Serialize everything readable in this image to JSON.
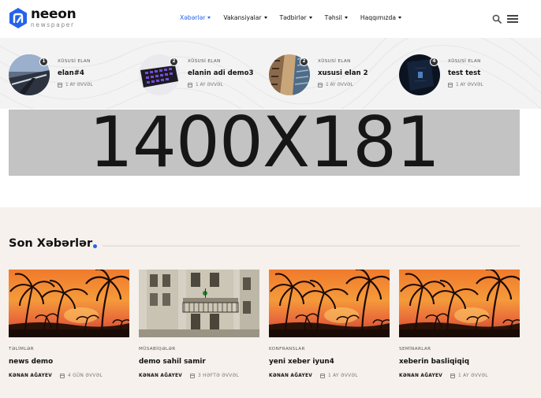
{
  "brand": {
    "name": "neeon",
    "tagline": "newspaper",
    "accent": "#2563eb"
  },
  "nav": [
    {
      "label": "Xəbərlər",
      "active": true
    },
    {
      "label": "Vakansiyalar",
      "active": false
    },
    {
      "label": "Tədbirlər",
      "active": false
    },
    {
      "label": "Təhsil",
      "active": false
    },
    {
      "label": "Haqqımızda",
      "active": false
    }
  ],
  "featured": [
    {
      "num": "1",
      "kicker": "XÜSUSİ ELAN",
      "title": "elan#4",
      "date": "1 AY ƏVVƏL",
      "icon": "landscape-thumb"
    },
    {
      "num": "2",
      "kicker": "XÜSUSİ ELAN",
      "title": "elanin adi demo3",
      "date": "1 AY ƏVVƏL",
      "icon": "keyboard-thumb"
    },
    {
      "num": "2",
      "kicker": "XÜSUSİ ELAN",
      "title": "xususi elan 2",
      "date": "1 AY ƏVVƏL",
      "icon": "buildings-thumb"
    },
    {
      "num": "4",
      "kicker": "XÜSUSİ ELAN",
      "title": "test test",
      "date": "1 AY ƏVVƏL",
      "icon": "dark-abstract-thumb"
    }
  ],
  "ad": {
    "text": "1400X181"
  },
  "latest": {
    "title": "Son Xəbərlər",
    "cards": [
      {
        "category": "TƏLİMLƏR",
        "title": "news demo",
        "author": "KƏNAN AĞAYEV",
        "date": "4 GÜN ƏVVƏL",
        "image": "sunset-palms"
      },
      {
        "category": "MÜSABİQƏLƏR",
        "title": "demo sahil samir",
        "author": "KƏNAN AĞAYEV",
        "date": "3 HƏFTƏ ƏVVƏL",
        "image": "old-building"
      },
      {
        "category": "KONFRANSLAR",
        "title": "yeni xeber iyun4",
        "author": "KƏNAN AĞAYEV",
        "date": "1 AY ƏVVƏL",
        "image": "sunset-palms"
      },
      {
        "category": "SEMİNARLAR",
        "title": "xeberin basliqiqiq",
        "author": "KƏNAN AĞAYEV",
        "date": "1 AY ƏVVƏL",
        "image": "sunset-palms"
      }
    ]
  }
}
